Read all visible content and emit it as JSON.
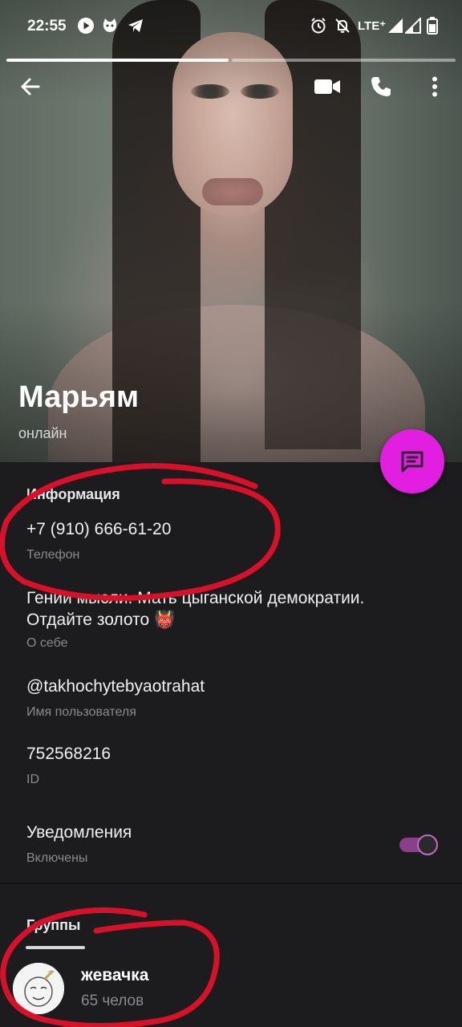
{
  "status_bar": {
    "time": "22:55",
    "network": "LTE⁺",
    "icons": [
      "play-circle-icon",
      "cat-app-icon",
      "telegram-icon",
      "alarm-icon",
      "notifications-off-icon",
      "signal-icon",
      "signal-icon",
      "battery-icon"
    ]
  },
  "profile": {
    "name": "Марьям",
    "status": "онлайн"
  },
  "info": {
    "section_title": "Информация",
    "phone": "+7 (910) 666-61-20",
    "phone_caption": "Телефон",
    "bio_line1": "Гении мысли. Мать цыганской демократии.",
    "bio_line2": "Отдайте золото 👹",
    "bio_caption": "О себе",
    "username": "@takhochytebyaotrahat",
    "username_caption": "Имя пользователя",
    "id": "752568216",
    "id_caption": "ID",
    "notifications_label": "Уведомления",
    "notifications_state": "Включены",
    "notifications_on": true
  },
  "groups": {
    "tab_title": "Группы",
    "items": [
      {
        "name": "жевачка",
        "members": "65 челов"
      }
    ]
  },
  "colors": {
    "accent": "#e21fe0",
    "toggle": "#8a3f8b",
    "annotation": "#d8102a",
    "background": "#1c1c1e"
  }
}
